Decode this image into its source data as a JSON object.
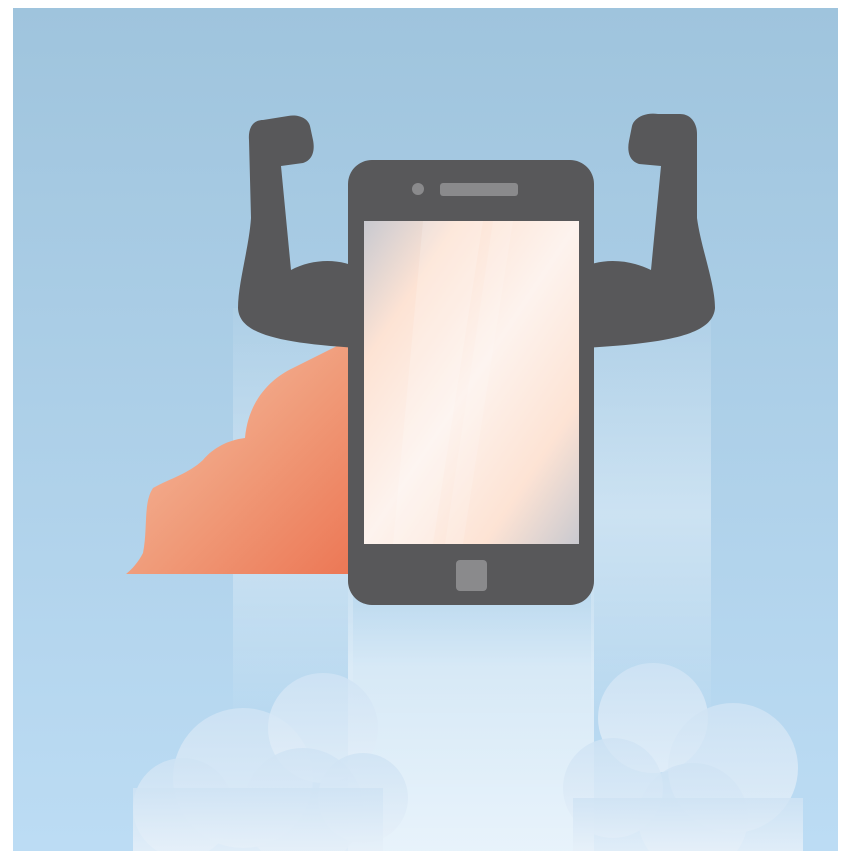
{
  "illustration": {
    "subject": "superhero-smartphone",
    "colors": {
      "sky_top": "#9fc4dd",
      "sky_bottom": "#bcdcf4",
      "phone_body": "#58585a",
      "phone_button": "#8a8a8c",
      "screen_light": "#fce9df",
      "screen_shade": "#c9c9cf",
      "cape_light": "#f4b79c",
      "cape_dark": "#ee7f5d",
      "cloud": "#d8e8f6",
      "trail": "#eaf3fb"
    },
    "icons": [
      "smartphone-icon",
      "flexed-arm-icon",
      "cape-icon",
      "cloud-icon",
      "speed-trail-icon"
    ]
  }
}
